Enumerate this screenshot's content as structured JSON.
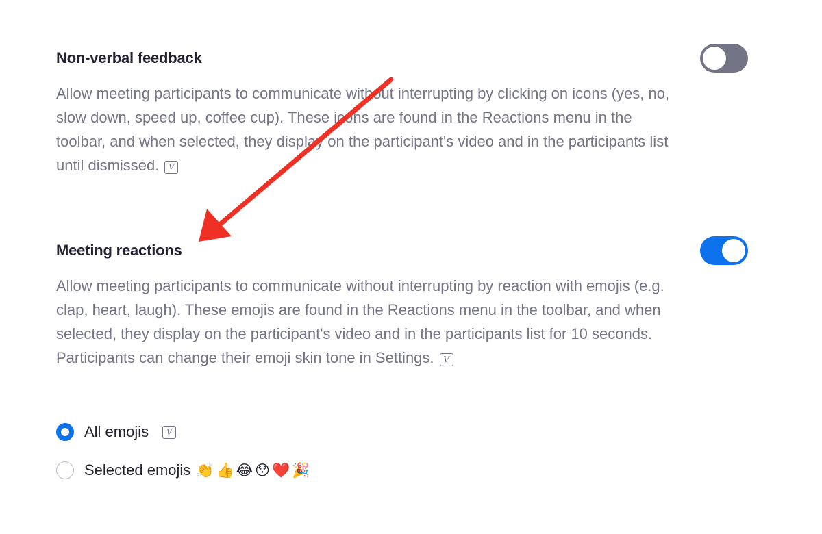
{
  "nonverbal": {
    "title": "Non-verbal feedback",
    "description": "Allow meeting participants to communicate without interrupting by clicking on icons (yes, no, slow down, speed up, coffee cup). These icons are found in the Reactions menu in the toolbar, and when selected, they display on the participant's video and in the participants list until dismissed.",
    "toggle_state": "off",
    "version_icon": "V"
  },
  "reactions": {
    "title": "Meeting reactions",
    "description": "Allow meeting participants to communicate without interrupting by reaction with emojis (e.g. clap, heart, laugh). These emojis are found in the Reactions menu in the toolbar, and when selected, they display on the participant's video and in the participants list for 10 seconds. Participants can change their emoji skin tone in Settings.",
    "toggle_state": "on",
    "version_icon": "V",
    "options": [
      {
        "label": "All emojis",
        "selected": true,
        "version_icon": "V"
      },
      {
        "label": "Selected emojis",
        "selected": false,
        "emojis": "👏👍😂😯❤️🎉"
      }
    ]
  },
  "colors": {
    "accent": "#0e72ed",
    "toggle_off": "#747487",
    "annotation_arrow": "#ee3124",
    "description_text": "#747487",
    "title_text": "#232333"
  },
  "icons": {
    "version_badge": "version-badge-icon",
    "annotation": "red-arrow-icon"
  }
}
